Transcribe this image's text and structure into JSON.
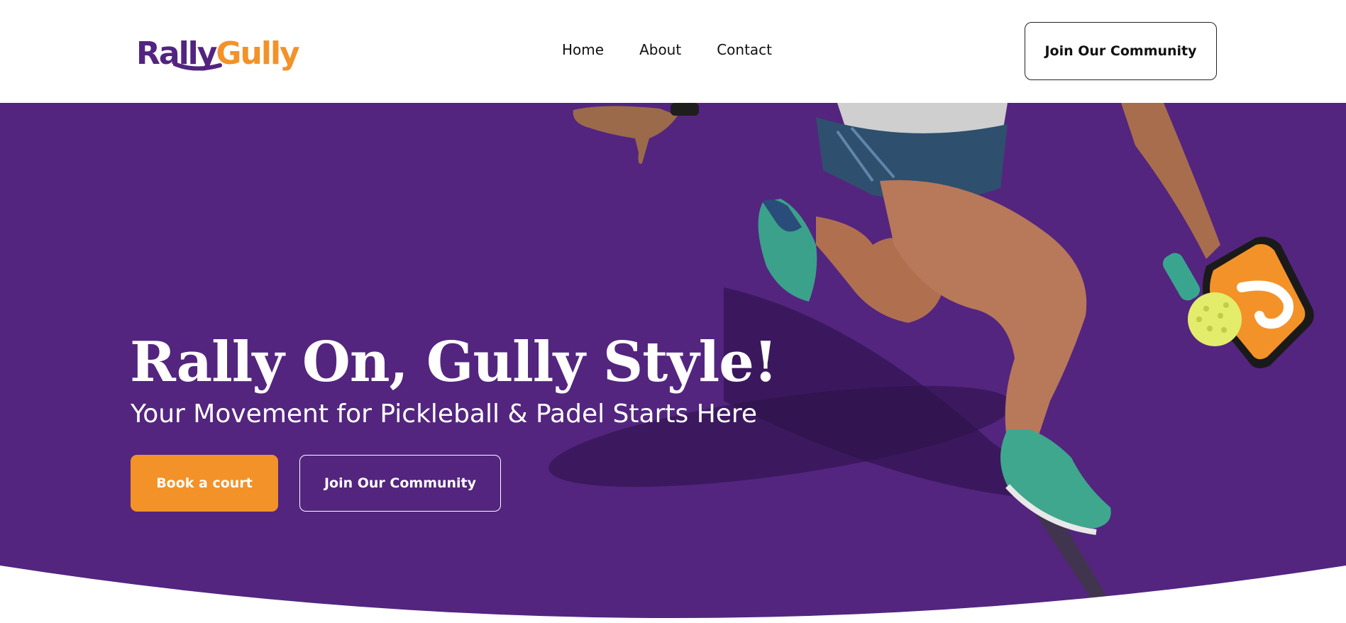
{
  "brand": {
    "logo_part1": "Rally",
    "logo_part2": "Gully",
    "primary_color": "#53257f",
    "accent_color": "#f39228"
  },
  "nav": {
    "links": [
      {
        "label": "Home"
      },
      {
        "label": "About"
      },
      {
        "label": "Contact"
      }
    ],
    "cta_label": "Join Our Community"
  },
  "hero": {
    "title": "Rally On, Gully Style!",
    "subtitle": "Your Movement for Pickleball & Padel Starts Here",
    "primary_button": "Book a court",
    "secondary_button": "Join Our Community",
    "image": "pickleball-player-image"
  }
}
